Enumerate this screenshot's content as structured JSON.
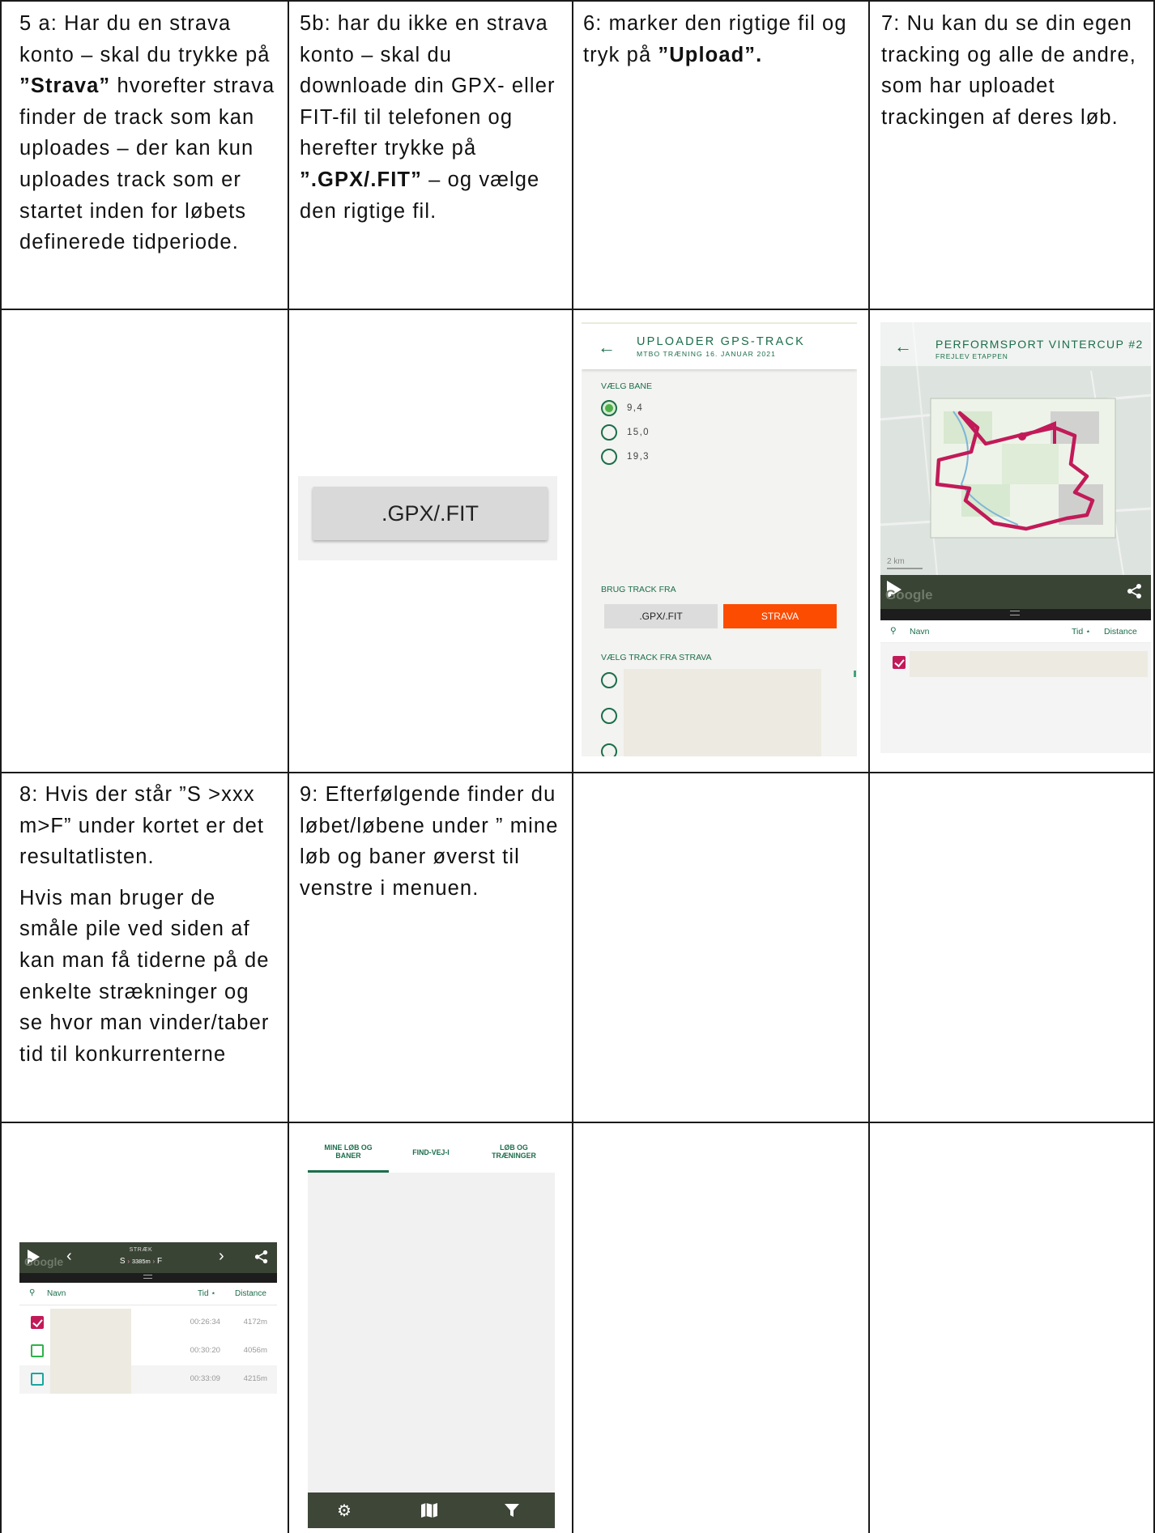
{
  "steps": {
    "step5a": {
      "prefix": "5 a: Har du en strava konto – skal du trykke på ",
      "bold": "”Strava”",
      "suffix": " hvorefter strava finder de track som kan uploades – der kan kun uploades track som er startet inden for løbets definerede tidperiode."
    },
    "step5b": {
      "prefix": "5b: har du ikke en strava konto – skal du downloade din GPX- eller FIT-fil til telefonen og herefter trykke på ",
      "bold": "”.GPX/.FIT”",
      "suffix": " – og vælge den rigtige fil."
    },
    "step6": {
      "prefix": "6: marker den rigtige fil og tryk på ",
      "bold": "”Upload”."
    },
    "step7": {
      "text": "7: Nu kan du se din egen tracking og alle de andre, som har uploadet trackingen af deres løb."
    },
    "step8": {
      "para1": "8: Hvis der står ”S >xxx m>F” under kortet er det resultatlisten.",
      "para2": "Hvis man bruger de småle pile ved siden af kan man få tiderne på de enkelte strækninger og se hvor man vinder/taber tid til konkurrenterne"
    },
    "step9": {
      "text": "9: Efterfølgende finder du løbet/løbene under ” mine løb og baner øverst til venstre i menuen."
    }
  },
  "gpx_screenshot": {
    "button_label": ".GPX/.FIT"
  },
  "upload_screenshot": {
    "title": "UPLOADER GPS-TRACK",
    "subtitle": "MTBO TRÆNING 16. JANUAR 2021",
    "choose_course_label": "VÆLG BANE",
    "courses": [
      "9,4",
      "15,0",
      "19,3"
    ],
    "use_track_from_label": "BRUG TRACK FRA",
    "gpx_button": ".GPX/.FIT",
    "strava_button": "STRAVA",
    "choose_strava_label": "VÆLG TRACK FRA STRAVA"
  },
  "map_screenshot": {
    "title": "PERFORMSPORT VINTERCUP #2",
    "subtitle": "FREJLEV ETAPPEN",
    "scale_label": "2 km",
    "google_label": "Google",
    "list_name": "Navn",
    "list_time": "Tid",
    "list_distance": "Distance"
  },
  "results_screenshot": {
    "google_label": "Google",
    "segment_title": "STRÆK",
    "segment_from": "S",
    "segment_distance": "3385m",
    "segment_to": "F",
    "list_name": "Navn",
    "list_time": "Tid",
    "list_distance": "Distance",
    "rows": [
      {
        "time": "00:26:34",
        "distance": "4172m"
      },
      {
        "time": "00:30:20",
        "distance": "4056m"
      },
      {
        "time": "00:33:09",
        "distance": "4215m"
      }
    ]
  },
  "tabs_screenshot": {
    "tab1_line1": "MINE LØB OG",
    "tab1_line2": "BANER",
    "tab2": "FIND-VEJ-I",
    "tab3_line1": "LØB OG",
    "tab3_line2": "TRÆNINGER"
  },
  "colors": {
    "brand_green": "#1b6e4b",
    "strava_orange": "#fc4c02",
    "track_magenta": "#c21a58",
    "dark_bar": "#3a4435"
  }
}
